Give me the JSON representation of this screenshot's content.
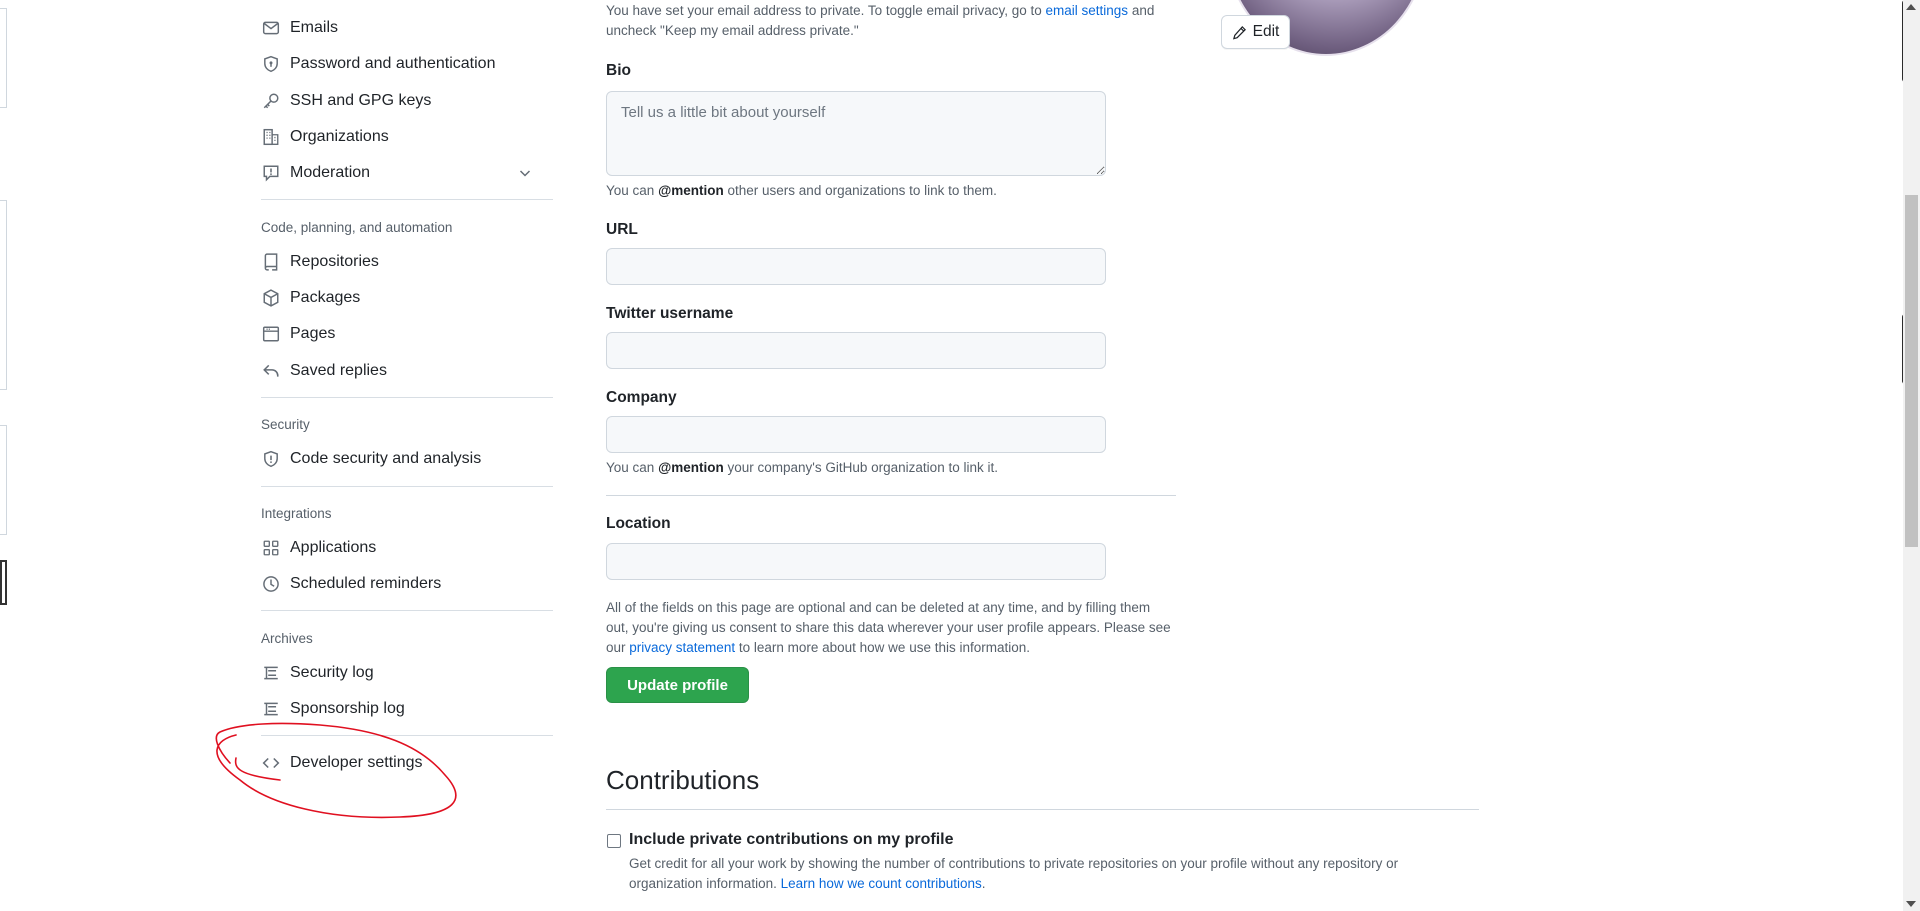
{
  "sidebar": {
    "top_items": [
      {
        "label": "Emails",
        "icon": "mail-icon"
      },
      {
        "label": "Password and authentication",
        "icon": "shield-lock-icon"
      },
      {
        "label": "SSH and GPG keys",
        "icon": "key-icon"
      },
      {
        "label": "Organizations",
        "icon": "organization-icon"
      },
      {
        "label": "Moderation",
        "icon": "report-icon"
      }
    ],
    "section_code": "Code, planning, and automation",
    "code_items": [
      {
        "label": "Repositories",
        "icon": "repo-icon"
      },
      {
        "label": "Packages",
        "icon": "package-icon"
      },
      {
        "label": "Pages",
        "icon": "browser-icon"
      },
      {
        "label": "Saved replies",
        "icon": "reply-icon"
      }
    ],
    "section_security": "Security",
    "security_items": [
      {
        "label": "Code security and analysis",
        "icon": "shield-icon"
      }
    ],
    "section_integrations": "Integrations",
    "integration_items": [
      {
        "label": "Applications",
        "icon": "apps-icon"
      },
      {
        "label": "Scheduled reminders",
        "icon": "clock-icon"
      }
    ],
    "section_archives": "Archives",
    "archive_items": [
      {
        "label": "Security log",
        "icon": "log-icon"
      },
      {
        "label": "Sponsorship log",
        "icon": "log-icon"
      }
    ],
    "developer_settings": {
      "label": "Developer settings",
      "icon": "code-icon"
    }
  },
  "main": {
    "email_note_1": "You have set your email address to private. To toggle email privacy, go to",
    "email_settings_link": "email settings",
    "email_note_and": "and",
    "email_note_2": "uncheck \"Keep my email address private.\"",
    "edit_button": "Edit",
    "bio": {
      "label": "Bio",
      "placeholder": "Tell us a little bit about yourself",
      "hint_pre": "You can",
      "hint_bold": "@mention",
      "hint_post": "other users and organizations to link to them."
    },
    "url": {
      "label": "URL",
      "value": ""
    },
    "twitter": {
      "label": "Twitter username",
      "value": ""
    },
    "company": {
      "label": "Company",
      "value": "",
      "hint_pre": "You can",
      "hint_bold": "@mention",
      "hint_post": "your company's GitHub organization to link it."
    },
    "location": {
      "label": "Location",
      "value": ""
    },
    "consent_1": "All of the fields on this page are optional and can be deleted at any time, and by filling them",
    "consent_2": "out, you're giving us consent to share this data wherever your user profile appears. Please see",
    "consent_3_pre": "our",
    "privacy_link": "privacy statement",
    "consent_3_post": "to learn more about how we use this information.",
    "update_button": "Update profile",
    "contributions": {
      "heading": "Contributions",
      "checkbox_label": "Include private contributions on my profile",
      "desc_1": "Get credit for all your work by showing the number of contributions to private repositories on your profile without any repository or",
      "desc_2_pre": "organization information.",
      "learn_link": "Learn how we count contributions",
      "desc_2_post": "."
    }
  },
  "colors": {
    "accent_green": "#2da44e",
    "link_blue": "#0969da",
    "annotation_red": "#e01020"
  }
}
